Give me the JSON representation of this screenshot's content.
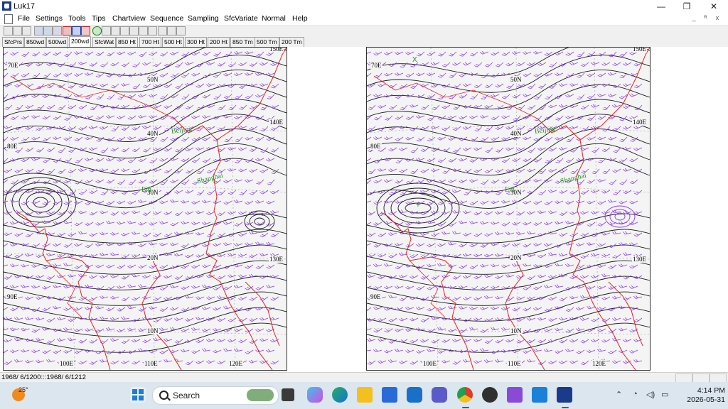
{
  "window": {
    "title": "Luk17",
    "minimize": "—",
    "maximize": "❐",
    "close": "✕"
  },
  "menu": {
    "items": [
      "File",
      "Settings",
      "Tools",
      "Tips",
      "Chartview",
      "Sequence",
      "Sampling",
      "SfcVariate",
      "Normal",
      "Help"
    ],
    "mdi_controls": [
      "_",
      "ᴿ",
      "x"
    ]
  },
  "toolbar_icons": [
    "new-icon",
    "open-icon",
    "save-icon",
    "rewind-icon",
    "step-back-icon",
    "stop-icon",
    "play-icon",
    "frame-icon",
    "fast-forward-icon",
    "globe-icon",
    "upload-icon",
    "grid-icon",
    "contour-icon",
    "barb-icon",
    "line-icon",
    "draw-icon",
    "window-icon",
    "camera-icon",
    "zoom-icon"
  ],
  "tabs": [
    "SfcPrs",
    "850wd",
    "500wd",
    "200wd",
    "SfcWat",
    "850 Ht",
    "700 Ht",
    "500 Ht",
    "300 Ht",
    "200 Ht",
    "850 Tm",
    "500 Tm",
    "200 Tm"
  ],
  "active_tab": "200wd",
  "charts": [
    {
      "labels": {
        "lon_70": "70E",
        "lon_80": "80E",
        "lon_90": "90E",
        "lon_100": "100E",
        "lon_110": "110E",
        "lon_120": "120E",
        "lon_130": "130E",
        "lon_140": "140E",
        "lon_150": "150E",
        "lat_50": "50N",
        "lat_40": "40N",
        "lat_30": "30N",
        "lat_20": "20N",
        "lat_10": "10N"
      },
      "cities": {
        "beijing": "Beijing",
        "shanghai": "Shanghai",
        "extra": "Em"
      }
    },
    {
      "labels": {
        "lon_70": "70E",
        "lon_80": "80E",
        "lon_90": "90E",
        "lon_100": "100E",
        "lon_110": "110E",
        "lon_120": "120E",
        "lon_130": "130E",
        "lon_140": "140E",
        "lon_150": "150E",
        "lat_50": "50N",
        "lat_40": "40N",
        "lat_30": "30N",
        "lat_20": "20N",
        "lat_10": "10N"
      },
      "cities": {
        "beijing": "Beijing",
        "shanghai": "Shanghai",
        "extra": "Em"
      },
      "markers": {
        "x": "X",
        "plus": "+"
      }
    }
  ],
  "status": {
    "text": "1968/ 6/1200:::1968/ 6/1212"
  },
  "taskbar": {
    "weather_temp": "25°",
    "search_placeholder": "Search",
    "apps": [
      "start-icon",
      "file-explorer-icon",
      "copilot-icon",
      "edge-icon",
      "folder-icon",
      "store-icon",
      "outlook-icon",
      "teams-icon",
      "chrome-icon",
      "media-icon",
      "visual-studio-icon",
      "remote-icon",
      "luk17-icon"
    ],
    "time": "4:14 PM",
    "date": "2026-05-31"
  },
  "colors": {
    "contour": "#1a1a1a",
    "wind_barb": "#8a3cf0",
    "coastline": "#e8221c",
    "grid": "#a0a0a0",
    "city_label": "#2a8a2a",
    "taskbar_bg": "#dce6ef",
    "chart_bg": "#f4f4f4"
  }
}
